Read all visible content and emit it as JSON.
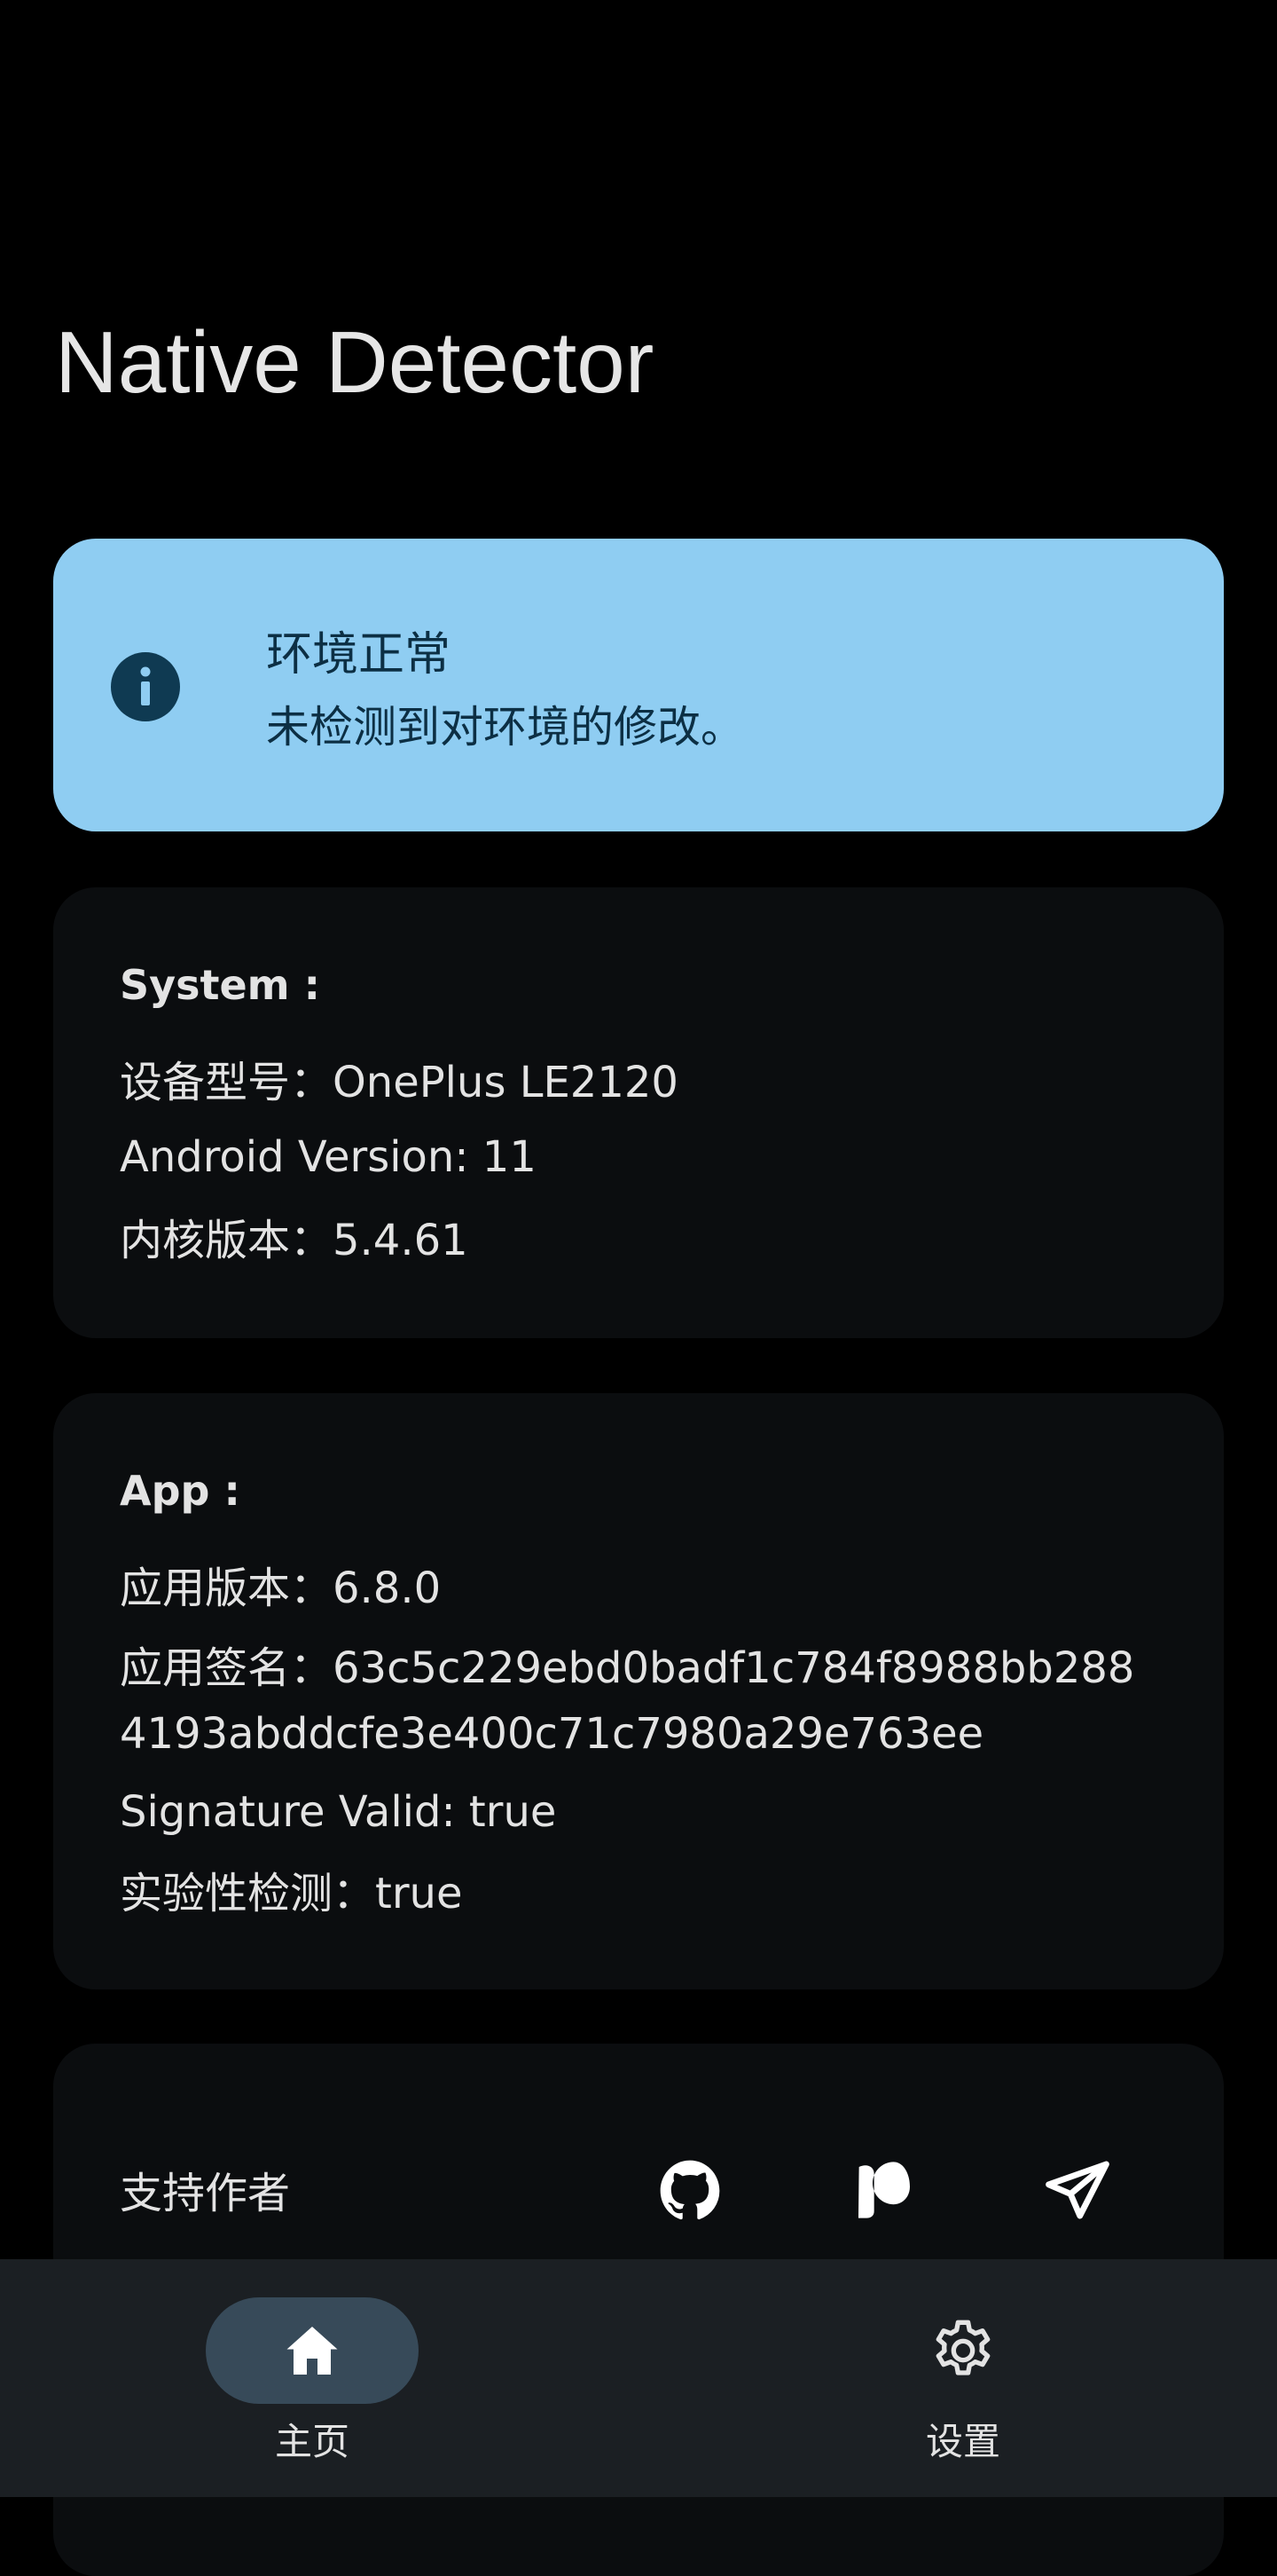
{
  "app": {
    "title": "Native Detector"
  },
  "status": {
    "icon": "info-icon",
    "title": "环境正常",
    "subtitle": "未检测到对环境的修改。",
    "colors": {
      "background": "#8fcdf2",
      "foreground": "#0c2f44"
    }
  },
  "system": {
    "heading": "System :",
    "device_model": "设备型号：OnePlus LE2120",
    "android_version": "Android Version: 11",
    "kernel_version": "内核版本：5.4.61"
  },
  "app_info": {
    "heading": "App :",
    "app_version": "应用版本：6.8.0",
    "signature_line1": "应用签名：63c5c229ebd0badf1c784f8988bb288",
    "signature_line2": "4193abddcfe3e400c71c7980a29e763ee",
    "signature_valid": "Signature Valid: true",
    "experimental": "实验性检测：true"
  },
  "support": {
    "label": "支持作者",
    "icons": [
      "github-icon",
      "patreon-icon",
      "telegram-icon"
    ]
  },
  "bottom_nav": {
    "items": [
      {
        "label": "主页",
        "icon": "home-icon",
        "selected": true
      },
      {
        "label": "设置",
        "icon": "gear-icon",
        "selected": false
      }
    ],
    "colors": {
      "background": "#1b1f23",
      "selected_pill": "#374a59"
    }
  }
}
